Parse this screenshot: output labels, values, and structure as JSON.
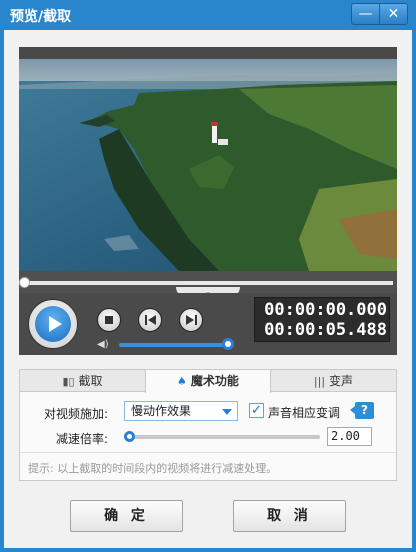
{
  "window": {
    "title": "预览/截取",
    "minimize_glyph": "—",
    "close_glyph": "✕"
  },
  "player": {
    "current_time": "00:00:00.000",
    "total_time": "00:00:05.488",
    "seek_progress": 0.0,
    "volume_level": 1.0,
    "collapse_glyph": "⌄",
    "icons": [
      "play-icon",
      "stop-icon",
      "previous-frame-icon",
      "next-frame-icon",
      "volume-icon"
    ]
  },
  "tabs": [
    {
      "label": "截取",
      "icon": "scissor-icon",
      "active": false
    },
    {
      "label": "魔术功能",
      "icon": "magic-hat-icon",
      "active": true
    },
    {
      "label": "变声",
      "icon": "voice-wave-icon",
      "active": false
    }
  ],
  "magic": {
    "apply_label": "对视频施加:",
    "effect_selected": "慢动作效果",
    "audio_sync_label": "声音相应变调",
    "audio_sync_checked": true,
    "help_label": "?",
    "rate_label": "减速倍率:",
    "rate_value": "2.00",
    "rate_slider_level": 0.0,
    "hint": "提示: 以上截取的时间段内的视频将进行减速处理。"
  },
  "buttons": {
    "ok": "确 定",
    "cancel": "取 消"
  },
  "colors": {
    "frame": "#2a86cc",
    "accent": "#2f7fd0",
    "client_bg": "#f1f1f1"
  }
}
